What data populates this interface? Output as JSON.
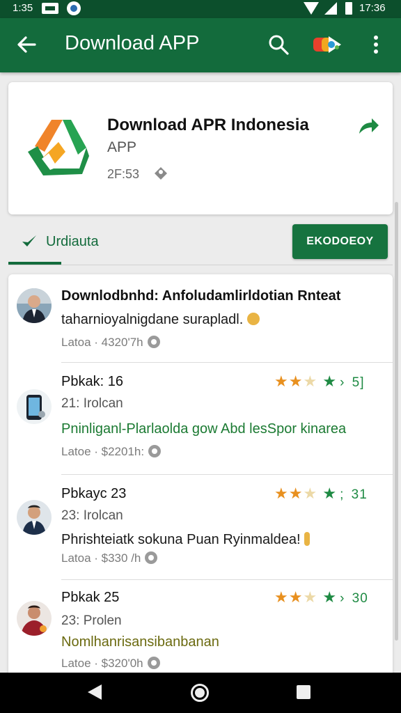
{
  "status_bar": {
    "time_left": "1:35",
    "time_right": "17:36"
  },
  "app_bar": {
    "title": "Download APP"
  },
  "app": {
    "name": "Download APR Indonesia",
    "type": "APP",
    "size": "2F:53"
  },
  "tabs": {
    "active_label": "Urdiauta"
  },
  "download_button": {
    "label": "EKODOEOY"
  },
  "reviews": [
    {
      "title": "Downlodbnhd: Anfoludamlirldotian Rnteat",
      "body": "taharnioyalnigdane surapladl.",
      "time": "Latoa · 4320'7h"
    },
    {
      "title": "Pbkak: 16",
      "rating": "5]",
      "sub": "21: Irolcan",
      "body": "Pninliganl-Plarlaolda gow Abd lesSpor kinarea",
      "time": "Latoe · $2201h:"
    },
    {
      "title": "Pbkayc 23",
      "rating": "31",
      "sub": "23: Irolcan",
      "body": "Phrishteiatk sokuna Puan Ryinmaldea!",
      "time": "Latoa · $330 /h"
    },
    {
      "title": "Pbkak 25",
      "rating": "30",
      "sub": "23: Prolen",
      "body": "Nomlhanrisansibanbanan",
      "time": "Latoe · $320'0h"
    }
  ],
  "colors": {
    "status_bar": "#0c4f2c",
    "app_bar": "#136b3c",
    "accent": "#16733f",
    "star_orange": "#e8901f",
    "star_green": "#1e8a43"
  },
  "icons": [
    "back-arrow-icon",
    "search-icon",
    "account-switch-icon",
    "more-vert-icon",
    "share-icon",
    "tag-icon",
    "check-icon",
    "clock-icon",
    "star-icon"
  ]
}
